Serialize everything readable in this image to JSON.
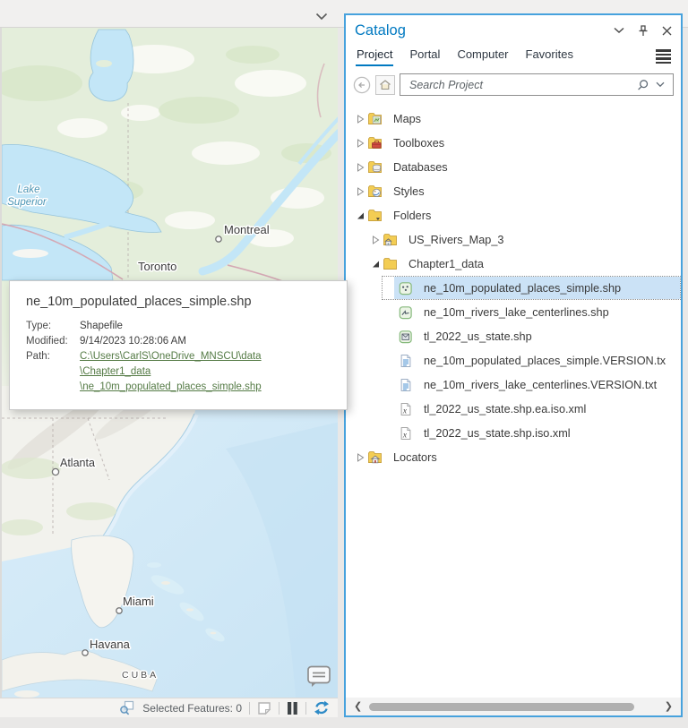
{
  "colors": {
    "accent_blue": "#0079c1",
    "panel_border": "#47a2dd",
    "selection_fill": "#cbe2f6",
    "link_green": "#557b46",
    "refresh_blue": "#2e8bc7",
    "lake_label": "#4a94b4"
  },
  "map": {
    "labels": {
      "lake_line1": "Lake",
      "lake_line2": "Superior",
      "montreal": "Montreal",
      "toronto": "Toronto",
      "atlanta": "Atlanta",
      "miami": "Miami",
      "havana": "Havana",
      "cuba": "CUBA"
    },
    "statusbar": {
      "selected_features": "Selected Features: 0"
    }
  },
  "tooltip": {
    "title": "ne_10m_populated_places_simple.shp",
    "type_label": "Type:",
    "type_value": "Shapefile",
    "modified_label": "Modified:",
    "modified_value": "9/14/2023 10:28:06 AM",
    "path_label": "Path:",
    "path_lines": [
      "C:\\Users\\CarlS\\OneDrive_MNSCU\\data",
      "\\Chapter1_data",
      "\\ne_10m_populated_places_simple.shp"
    ]
  },
  "catalog": {
    "title": "Catalog",
    "tabs": [
      "Project",
      "Portal",
      "Computer",
      "Favorites"
    ],
    "active_tab": "Project",
    "search_placeholder": "Search Project",
    "tree": [
      {
        "label": "Maps",
        "icon": "folder-maps",
        "level": 0,
        "expander": "collapsed"
      },
      {
        "label": "Toolboxes",
        "icon": "folder-toolboxes",
        "level": 0,
        "expander": "collapsed"
      },
      {
        "label": "Databases",
        "icon": "folder-databases",
        "level": 0,
        "expander": "collapsed"
      },
      {
        "label": "Styles",
        "icon": "folder-styles",
        "level": 0,
        "expander": "collapsed"
      },
      {
        "label": "Folders",
        "icon": "folder-root",
        "level": 0,
        "expander": "expanded"
      },
      {
        "label": "US_Rivers_Map_3",
        "icon": "folder-home",
        "level": 1,
        "expander": "collapsed"
      },
      {
        "label": "Chapter1_data",
        "icon": "folder-plain",
        "level": 1,
        "expander": "expanded"
      },
      {
        "label": "ne_10m_populated_places_simple.shp",
        "icon": "shp-point",
        "level": 2,
        "selected": true
      },
      {
        "label": "ne_10m_rivers_lake_centerlines.shp",
        "icon": "shp-line",
        "level": 2
      },
      {
        "label": "tl_2022_us_state.shp",
        "icon": "shp-polygon",
        "level": 2
      },
      {
        "label": "ne_10m_populated_places_simple.VERSION.tx",
        "icon": "file-txt",
        "level": 2
      },
      {
        "label": "ne_10m_rivers_lake_centerlines.VERSION.txt",
        "icon": "file-txt",
        "level": 2
      },
      {
        "label": "tl_2022_us_state.shp.ea.iso.xml",
        "icon": "file-xml",
        "level": 2
      },
      {
        "label": "tl_2022_us_state.shp.iso.xml",
        "icon": "file-xml",
        "level": 2
      },
      {
        "label": "Locators",
        "icon": "folder-locators",
        "level": 0,
        "expander": "collapsed"
      }
    ]
  }
}
